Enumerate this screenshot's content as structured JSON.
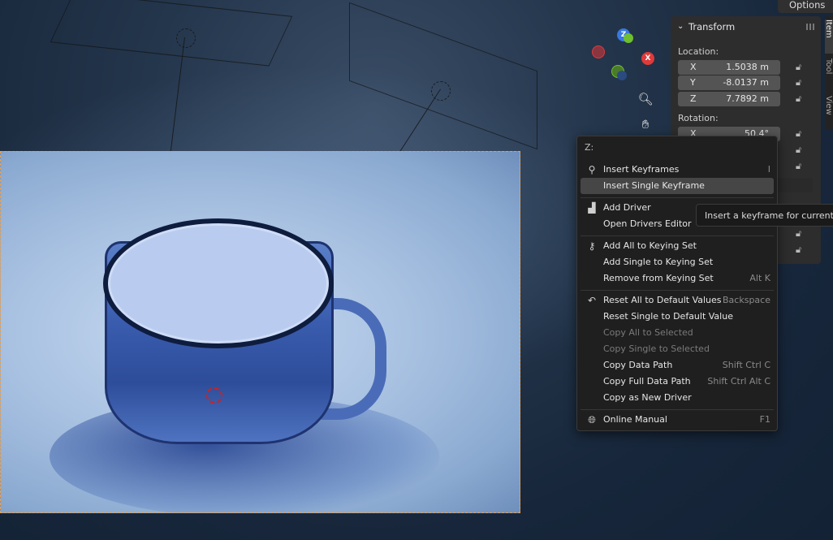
{
  "header": {
    "options_label": "Options"
  },
  "gizmo": {
    "z_label": "Z",
    "x_label": "X",
    "colors": {
      "x": "#e03a3a",
      "y": "#6fbf30",
      "z": "#3a78e0"
    }
  },
  "viewport_tools": {
    "zoom_icon": "zoom-icon",
    "pan_icon": "hand-pan-icon"
  },
  "sidebar": {
    "tabs": [
      "Item",
      "Tool",
      "View"
    ],
    "panel_title": "Transform",
    "location_label": "Location:",
    "location": [
      {
        "axis": "X",
        "value": "1.5038 m"
      },
      {
        "axis": "Y",
        "value": "-8.0137 m"
      },
      {
        "axis": "Z",
        "value": "7.7892 m"
      }
    ],
    "rotation_label": "Rotation:",
    "rotation": [
      {
        "axis": "X",
        "value": "50.4°"
      }
    ]
  },
  "context_menu": {
    "title": "Z:",
    "items": [
      {
        "label": "Insert Keyframes",
        "shortcut": "I",
        "icon": "keyframe-add-icon"
      },
      {
        "label": "Insert Single Keyframe",
        "shortcut": ""
      },
      {
        "label": "Add Driver",
        "shortcut": "",
        "icon": "driver-icon"
      },
      {
        "label": "Open Drivers Editor",
        "shortcut": ""
      },
      {
        "label": "Add All to Keying Set",
        "shortcut": "",
        "icon": "keying-set-icon"
      },
      {
        "label": "Add Single to Keying Set",
        "shortcut": ""
      },
      {
        "label": "Remove from Keying Set",
        "shortcut": "Alt K"
      },
      {
        "label": "Reset All to Default Values",
        "shortcut": "Backspace",
        "icon": "reset-icon"
      },
      {
        "label": "Reset Single to Default Value",
        "shortcut": ""
      },
      {
        "label": "Copy All to Selected",
        "shortcut": ""
      },
      {
        "label": "Copy Single to Selected",
        "shortcut": ""
      },
      {
        "label": "Copy Data Path",
        "shortcut": "Shift Ctrl C"
      },
      {
        "label": "Copy Full Data Path",
        "shortcut": "Shift Ctrl Alt C"
      },
      {
        "label": "Copy as New Driver",
        "shortcut": ""
      },
      {
        "label": "Online Manual",
        "shortcut": "F1",
        "icon": "globe-icon"
      }
    ]
  },
  "tooltip": {
    "text": "Insert a keyframe for current U"
  }
}
